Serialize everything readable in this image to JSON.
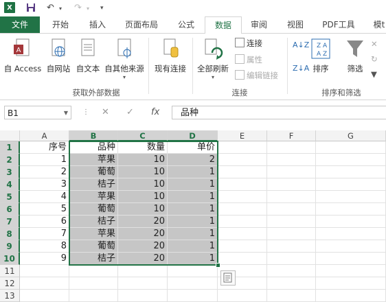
{
  "qat": {
    "app": "X",
    "save": "💾",
    "undo": "↶",
    "redo": "↷"
  },
  "tabs": [
    "文件",
    "开始",
    "插入",
    "页面布局",
    "公式",
    "数据",
    "审阅",
    "视图",
    "PDF工具",
    "模t"
  ],
  "ribbon": {
    "get_external": [
      "自 Access",
      "自网站",
      "自文本",
      "自其他来源"
    ],
    "existing": "现有连接",
    "refresh": "全部刷新",
    "connections": {
      "link": "连接",
      "props": "属性",
      "edit": "编辑链接"
    },
    "sort": "排序",
    "filter": "筛选",
    "groups": {
      "external": "获取外部数据",
      "conn": "连接",
      "sortfilter": "排序和筛选"
    }
  },
  "namebox": "B1",
  "formula": "品种",
  "columns": [
    "A",
    "B",
    "C",
    "D",
    "E",
    "F",
    "G"
  ],
  "rows": [
    "1",
    "2",
    "3",
    "4",
    "5",
    "6",
    "7",
    "8",
    "9",
    "10",
    "11",
    "12",
    "13"
  ],
  "table": [
    [
      "序号",
      "品种",
      "数量",
      "单价"
    ],
    [
      "1",
      "苹果",
      "10",
      "2"
    ],
    [
      "2",
      "葡萄",
      "10",
      "1"
    ],
    [
      "3",
      "桔子",
      "10",
      "1"
    ],
    [
      "4",
      "苹果",
      "10",
      "1"
    ],
    [
      "5",
      "葡萄",
      "10",
      "1"
    ],
    [
      "6",
      "桔子",
      "20",
      "1"
    ],
    [
      "7",
      "苹果",
      "20",
      "1"
    ],
    [
      "8",
      "葡萄",
      "20",
      "1"
    ],
    [
      "9",
      "桔子",
      "20",
      "1"
    ]
  ]
}
